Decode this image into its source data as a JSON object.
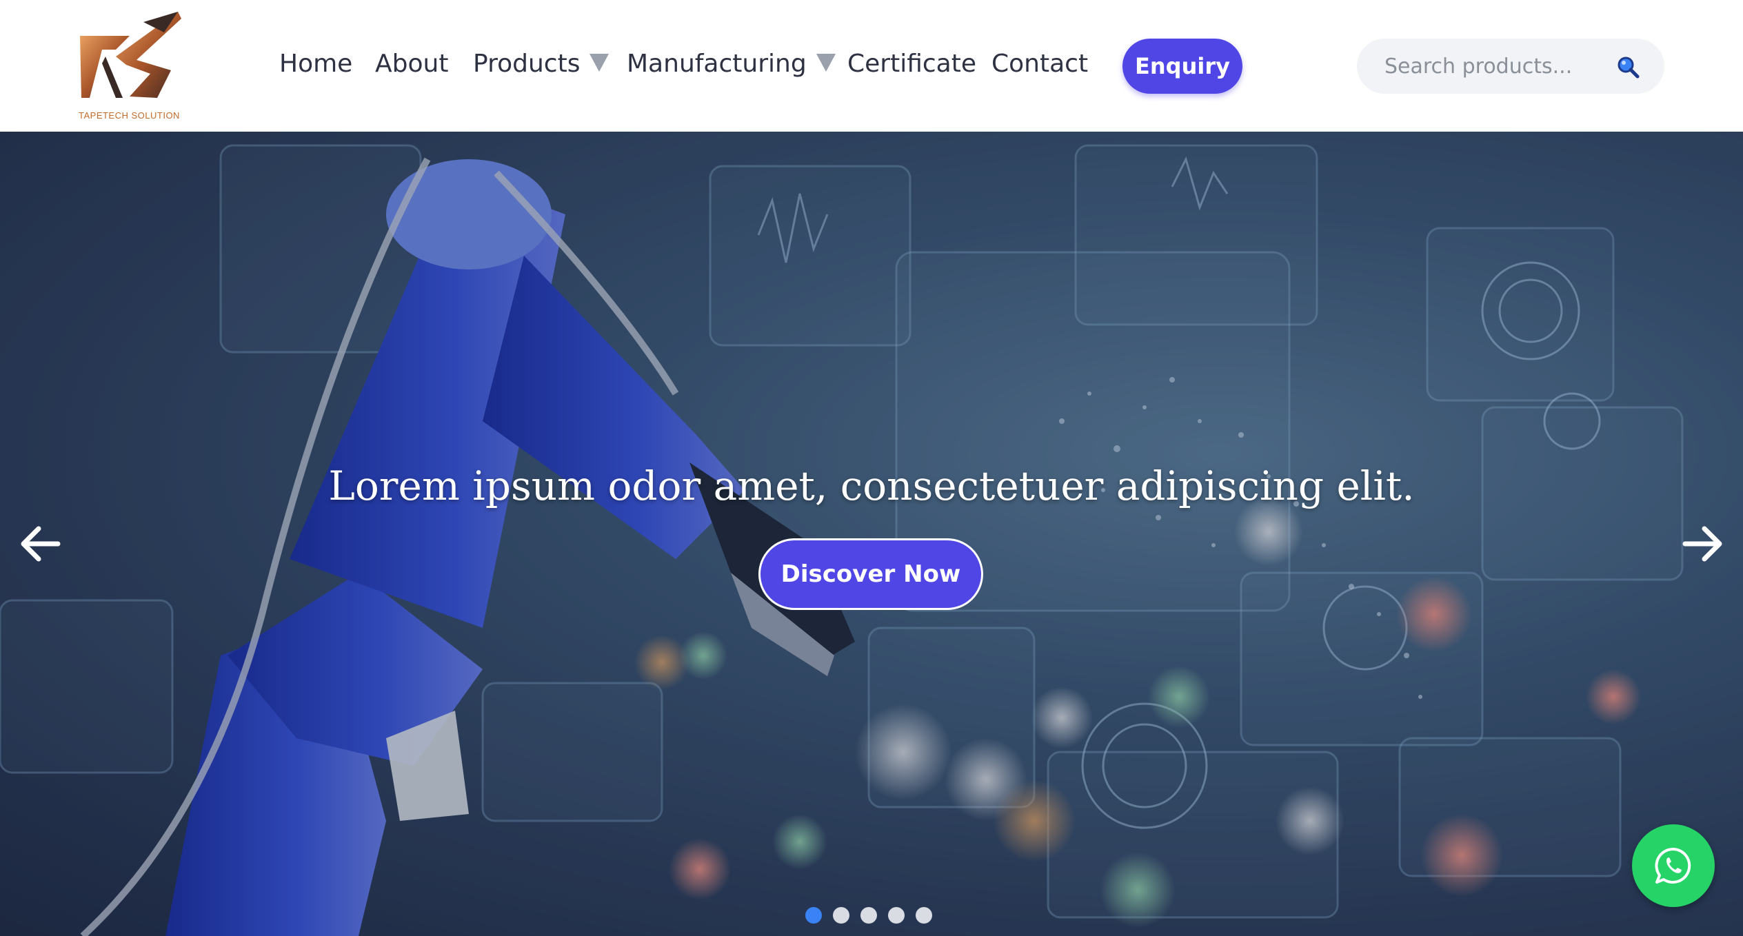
{
  "brand": {
    "name": "TAPETECH SOLUTION",
    "logo_color": "#c26a2a"
  },
  "nav": {
    "items": [
      {
        "label": "Home",
        "dropdown": false
      },
      {
        "label": "About",
        "dropdown": false
      },
      {
        "label": "Products",
        "dropdown": true
      },
      {
        "label": "Manufacturing",
        "dropdown": true
      },
      {
        "label": "Certificate",
        "dropdown": false
      },
      {
        "label": "Contact",
        "dropdown": false
      }
    ],
    "enquiry_label": "Enquiry"
  },
  "search": {
    "placeholder": "Search products...",
    "value": "",
    "icon": "magnifier-icon"
  },
  "hero": {
    "headline": "Lorem ipsum odor amet, consectetuer adipiscing elit.",
    "cta_label": "Discover Now",
    "prev_icon": "arrow-left-icon",
    "next_icon": "arrow-right-icon",
    "slides": 5,
    "active_slide": 1
  },
  "floating": {
    "icon": "whatsapp-icon"
  },
  "colors": {
    "accent": "#4f46e5",
    "dot_active": "#3b82f6",
    "whatsapp": "#25d366",
    "nav_text": "#2d3142"
  }
}
